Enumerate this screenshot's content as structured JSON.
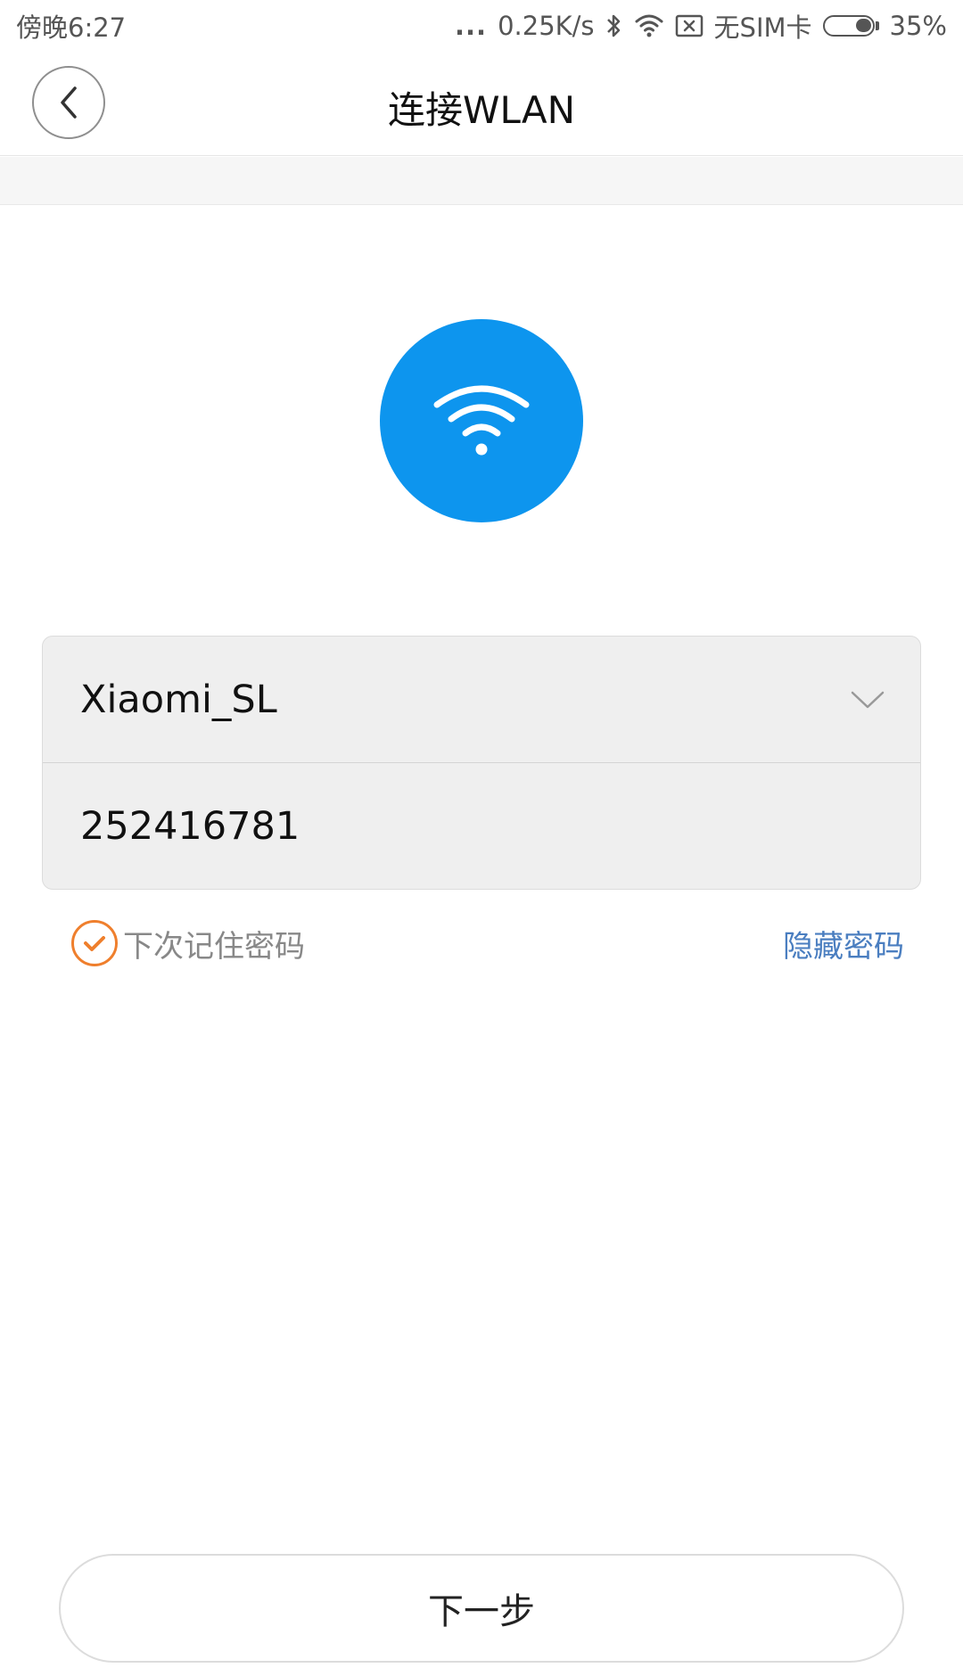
{
  "status_bar": {
    "time": "傍晚6:27",
    "dots": "...",
    "net_speed": "0.25K/s",
    "sim": "无SIM卡",
    "battery": "35%",
    "battery_level_percent": 35,
    "icons": [
      "bluetooth-icon",
      "wifi-icon",
      "no-sim-icon",
      "battery-icon"
    ]
  },
  "header": {
    "title": "连接WLAN",
    "back_icon": "chevron-left-icon"
  },
  "emblem": {
    "icon": "wifi-icon",
    "color": "#0d95ee"
  },
  "form": {
    "ssid": "Xiaomi_SL",
    "password": "252416781",
    "dropdown_icon": "chevron-down-icon"
  },
  "options": {
    "remember_label": "下次记住密码",
    "remember_checked": true,
    "hide_password_label": "隐藏密码",
    "accent_color": "#ef7f2d",
    "link_color": "#4a7ec0"
  },
  "footer": {
    "next_label": "下一步"
  }
}
